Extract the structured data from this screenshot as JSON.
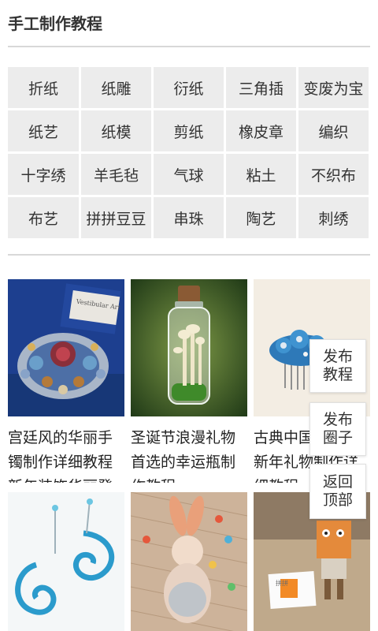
{
  "header": {
    "title": "手工制作教程"
  },
  "tags": [
    "折纸",
    "纸雕",
    "衍纸",
    "三角插",
    "变废为宝",
    "纸艺",
    "纸模",
    "剪纸",
    "橡皮章",
    "编织",
    "十字绣",
    "羊毛毡",
    "气球",
    "粘土",
    "不织布",
    "布艺",
    "拼拼豆豆",
    "串珠",
    "陶艺",
    "刺绣"
  ],
  "cards": [
    {
      "title": "宫廷风的华丽手镯制作详细教程 新年装饰华丽登"
    },
    {
      "title": "圣诞节浪漫礼物首选的幸运瓶制作教程"
    },
    {
      "title": "古典中国风发梳 新年礼物制作详细教程"
    },
    {
      "title": ""
    },
    {
      "title": ""
    },
    {
      "title": ""
    }
  ],
  "card_images": {
    "0": "瓷 jewelry thumbnail",
    "2": ""
  },
  "thumb_texts": {
    "box_label": "Vestibular Art",
    "sign_text": "拼拼"
  },
  "floating": {
    "publish_tutorial": "发布\n教程",
    "publish_circle": "发布\n圈子",
    "back_to_top": "返回\n顶部"
  }
}
